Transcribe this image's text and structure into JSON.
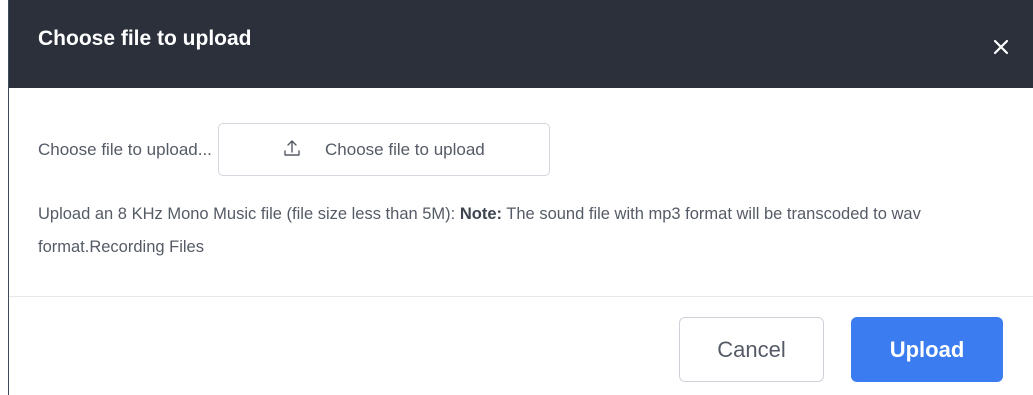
{
  "dialog": {
    "title": "Choose file to upload",
    "close_icon": "close-icon"
  },
  "body": {
    "file_label": "Choose file to upload...",
    "choose_button_label": "Choose file to upload",
    "upload_icon": "upload-icon",
    "help_text_prefix": "Upload an 8 KHz Mono Music file (file size less than 5M): ",
    "note_label": "Note:",
    "help_text_suffix": " The sound file with mp3 format will be transcoded to wav format.Recording Files"
  },
  "footer": {
    "cancel_label": "Cancel",
    "upload_label": "Upload"
  },
  "colors": {
    "header_bg": "#2b303b",
    "primary": "#3b7cf0"
  }
}
